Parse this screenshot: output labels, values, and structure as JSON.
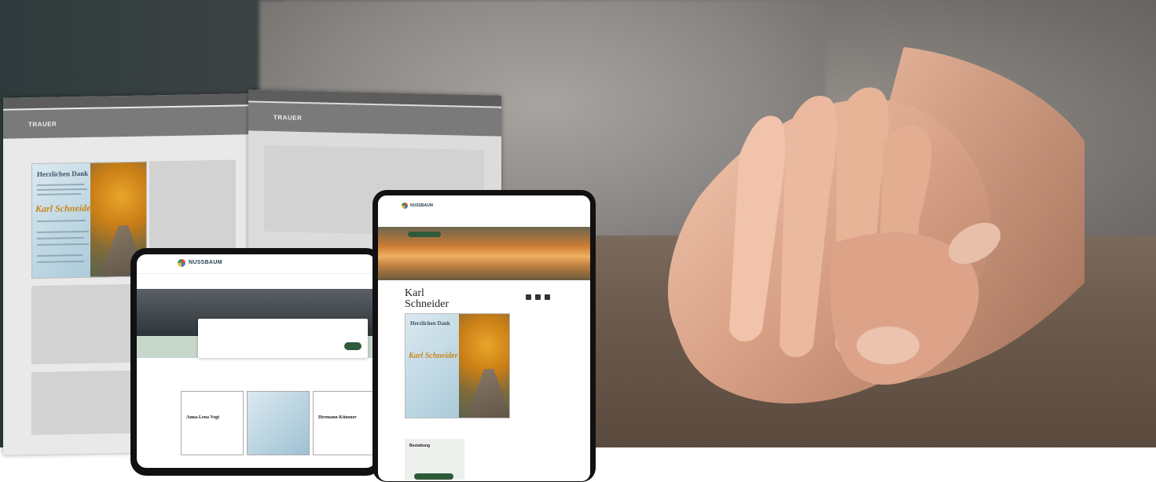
{
  "magazine": {
    "left_page_section": "TRAUER",
    "right_page_section": "TRAUER",
    "ad_title": "Herzlichen Dank",
    "ad_name": "Karl Schneider"
  },
  "laptop": {
    "logo": "NUSSBAUM",
    "card_name": "Anna-Lena Vogt",
    "card_name_2": "Hermann Künzner"
  },
  "tablet": {
    "logo": "NUSSBAUM",
    "deceased_name_line1": "Karl",
    "deceased_name_line2": "Schneider",
    "card_title": "Herzlichen Dank",
    "card_name": "Karl Schneider",
    "box_title": "Bestattung"
  }
}
